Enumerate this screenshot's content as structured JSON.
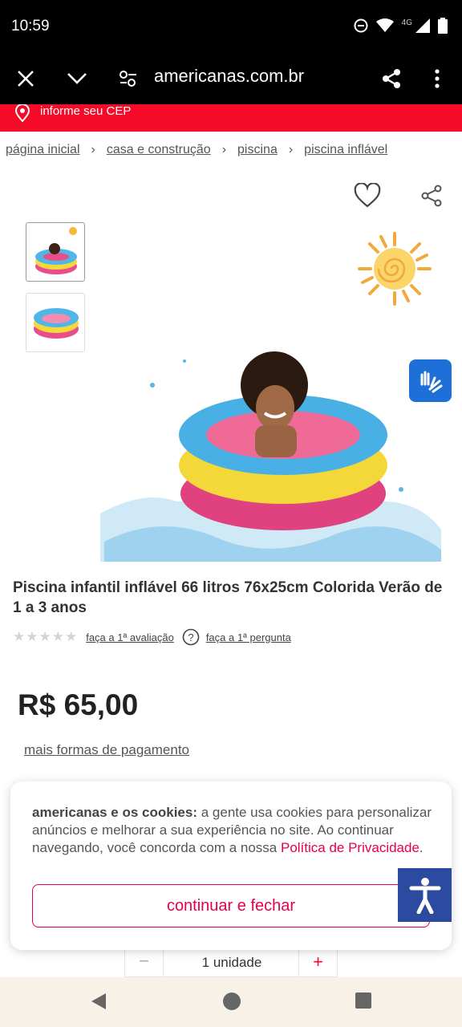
{
  "status": {
    "time": "10:59",
    "network": "4G"
  },
  "browser": {
    "url": "americanas.com.br"
  },
  "cep": {
    "label": "informe seu CEP"
  },
  "breadcrumb": [
    {
      "label": "página inicial"
    },
    {
      "label": "casa e construção"
    },
    {
      "label": "piscina"
    },
    {
      "label": "piscina inflável"
    }
  ],
  "product": {
    "title": "Piscina infantil inflável 66 litros 76x25cm Colorida Verão de 1 a 3 anos",
    "rating_link": "faça a 1ª avaliação",
    "question_link": "faça a 1ª pergunta",
    "stars": 0,
    "price": "R$ 65,00",
    "payment_link": "mais formas de pagamento"
  },
  "quantity": {
    "value": "1 unidade",
    "minus": "−",
    "plus": "+"
  },
  "cookie": {
    "bold": "americanas e os cookies:",
    "text": " a gente usa cookies para personalizar anúncios e melhorar a sua experiência no site. Ao continuar navegando, você concorda com a nossa ",
    "link": "Política de Privacidade",
    "end": ".",
    "button": "continuar e fechar"
  },
  "colors": {
    "brand_red": "#f50a28",
    "cookie_pink": "#e6004c",
    "a11y_blue": "#2c4ba0"
  }
}
